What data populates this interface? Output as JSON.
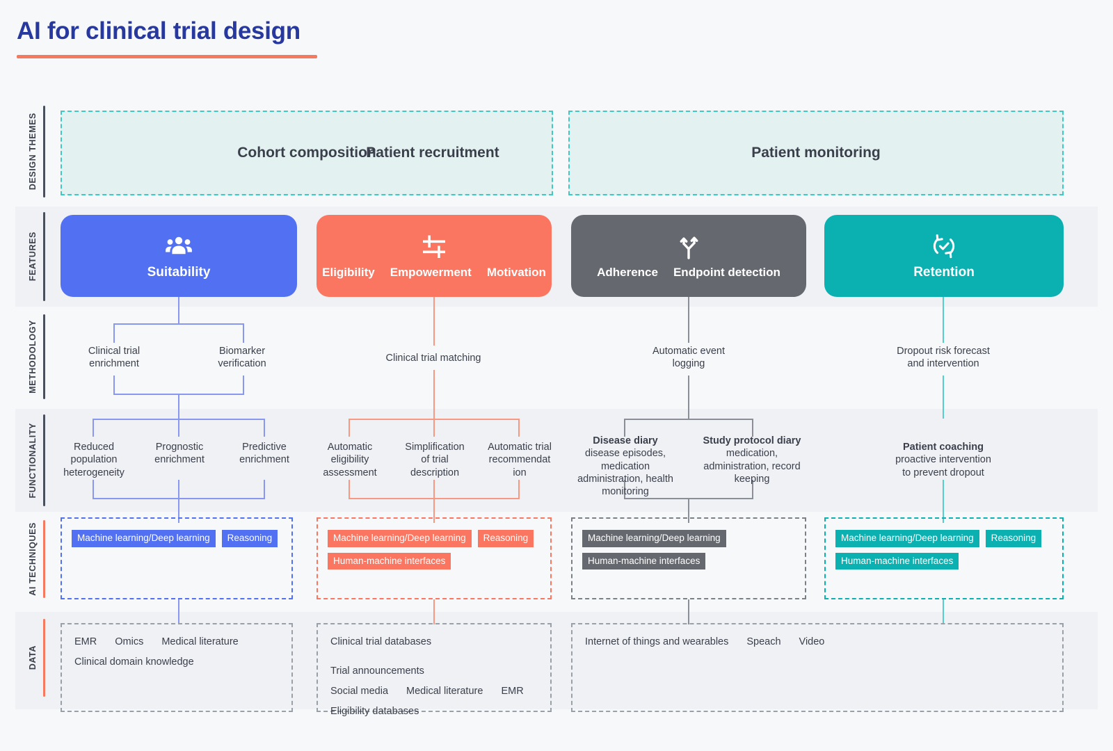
{
  "title": "AI for clinical trial design",
  "rows": [
    {
      "label": "DESIGN THEMES"
    },
    {
      "label": "FEATURES"
    },
    {
      "label": "METHODOLOGY"
    },
    {
      "label": "FUNCTIONALITY"
    },
    {
      "label": "AI TECHNIQUES"
    },
    {
      "label": "DATA"
    }
  ],
  "themes": [
    {
      "label": "Cohort composition"
    },
    {
      "label": "Patient recruitment"
    },
    {
      "label": "Patient monitoring"
    }
  ],
  "features": [
    {
      "icon": "people-group-icon",
      "labels": [
        "Suitability"
      ],
      "color": "#5271F2"
    },
    {
      "icon": "sliders-filter-icon",
      "labels": [
        "Eligibility",
        "Empowerment",
        "Motivation"
      ],
      "color": "#FA7661"
    },
    {
      "icon": "branching-arrows-icon",
      "labels": [
        "Adherence",
        "Endpoint detection"
      ],
      "color": "#65696F"
    },
    {
      "icon": "refresh-check-cycle-icon",
      "labels": [
        "Retention"
      ],
      "color": "#0BB0B0"
    }
  ],
  "methodology": [
    {
      "label": "Clinical trial\nenrichment"
    },
    {
      "label": "Biomarker\nverification"
    },
    {
      "label": "Clinical trial matching"
    },
    {
      "label": "Automatic event\nlogging"
    },
    {
      "label": "Dropout risk forecast\nand intervention"
    }
  ],
  "functionality": [
    {
      "title": "",
      "text": "Reduced\npopulation\nheterogeneity"
    },
    {
      "title": "",
      "text": "Prognostic\nenrichment"
    },
    {
      "title": "",
      "text": "Predictive\nenrichment"
    },
    {
      "title": "",
      "text": "Automatic\neligibility\nassessment"
    },
    {
      "title": "",
      "text": "Simplification\nof trial\ndescription"
    },
    {
      "title": "",
      "text": "Automatic trial\nrecommendat\nion"
    },
    {
      "title": "Disease diary",
      "text": "disease episodes,\nmedication\nadministration, health\nmonitoring"
    },
    {
      "title": "Study protocol diary",
      "text": "medication,\nadministration, record\nkeeping"
    },
    {
      "title": "Patient coaching",
      "text": "proactive intervention\nto prevent dropout"
    }
  ],
  "ai_techniques": [
    {
      "color": "#5271F2",
      "tags": [
        "Machine learning/Deep learning",
        "Reasoning"
      ]
    },
    {
      "color": "#FA7661",
      "tags": [
        "Machine learning/Deep learning",
        "Reasoning",
        "Human-machine interfaces"
      ]
    },
    {
      "color": "#65696F",
      "tags": [
        "Machine learning/Deep learning",
        "Human-machine interfaces"
      ]
    },
    {
      "color": "#0BB0B0",
      "tags": [
        "Machine learning/Deep learning",
        "Reasoning",
        "Human-machine interfaces"
      ]
    }
  ],
  "data": [
    {
      "lines": [
        [
          "EMR",
          "Omics",
          "Medical literature"
        ],
        [
          "Clinical domain knowledge"
        ]
      ]
    },
    {
      "lines": [
        [
          "Clinical trial databases",
          "Trial announcements"
        ],
        [
          "Social media",
          "Medical literature",
          "EMR"
        ],
        [
          "Eligibility databases"
        ]
      ]
    },
    {
      "lines": [
        [
          "Internet of things and wearables",
          "Speach",
          "Video"
        ]
      ]
    }
  ],
  "colors": {
    "title": "#27389E",
    "rule": "#F4795F",
    "theme_fill": "#E3F2F1",
    "theme_border": "#3EC9C4",
    "band": "#F0F1F5",
    "page": "#F7F8FA"
  }
}
